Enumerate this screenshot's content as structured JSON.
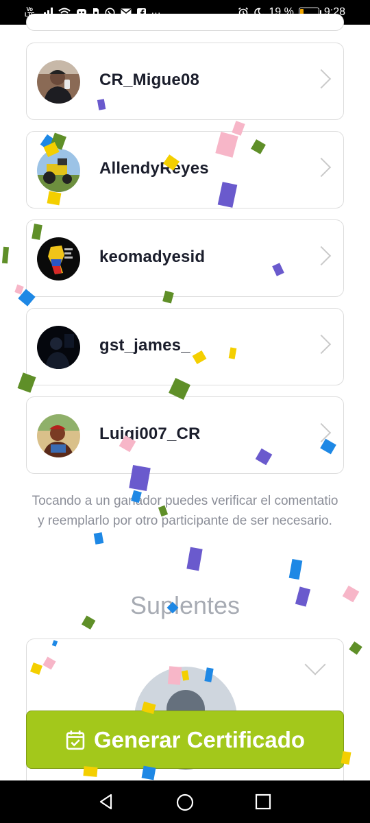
{
  "status_bar": {
    "volte_top": "Vo",
    "volte_bottom": "LTE",
    "battery_percent": "19 %",
    "battery_level": 0.19,
    "time": "9:28",
    "overflow": "···"
  },
  "winners": [
    {
      "username": "CR_Migue08"
    },
    {
      "username": "AllendyReyes"
    },
    {
      "username": "keomadyesid"
    },
    {
      "username": "gst_james_"
    },
    {
      "username": "Luigi007_CR"
    }
  ],
  "note": "Tocando a un ganador puedes verificar el comentatio y reemplarlo por otro participante de ser necesario.",
  "suplentes_title": "Suplentes",
  "cta_label": "Generar Certificado",
  "colors": {
    "cta_background": "#a3c81b",
    "username": "#1b1e2c",
    "muted_text": "#8b8e98",
    "battery": "#f0a500"
  }
}
